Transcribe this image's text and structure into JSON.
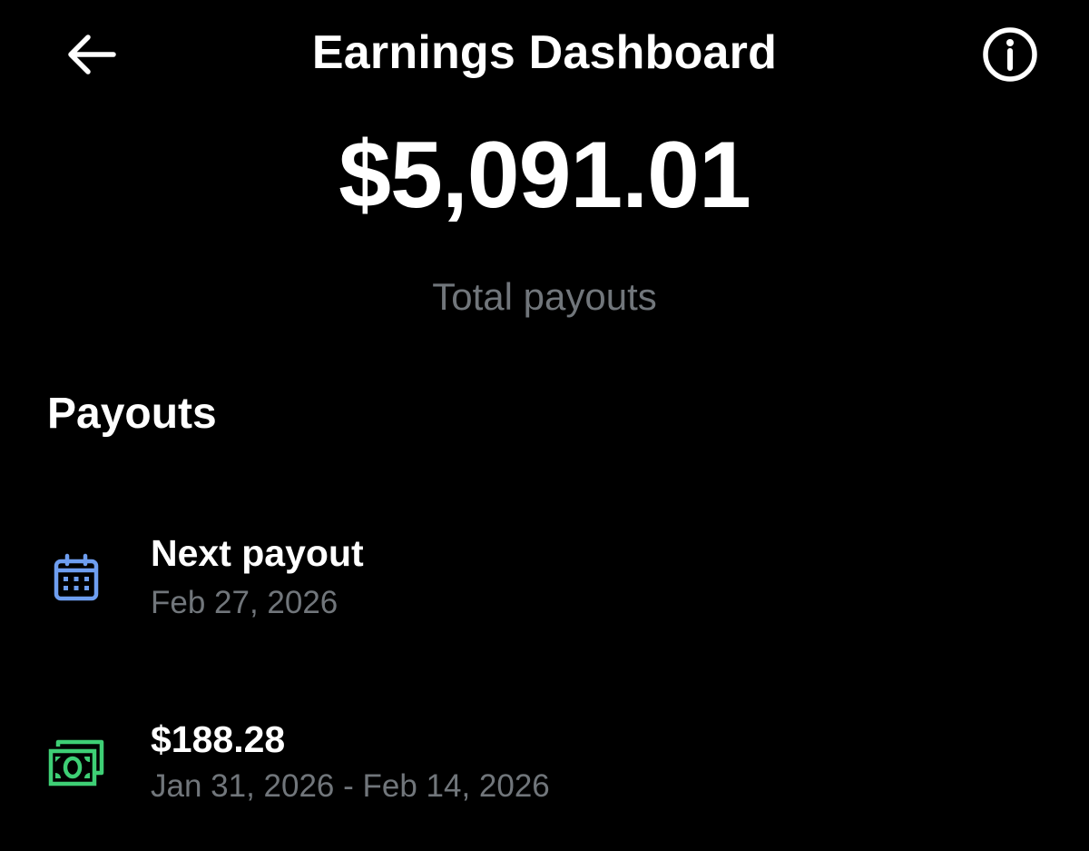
{
  "header": {
    "back_icon": "arrow-left-icon",
    "title": "Earnings Dashboard",
    "info_icon": "info-circle-icon"
  },
  "summary": {
    "total_amount": "$5,091.01",
    "total_label": "Total payouts"
  },
  "payouts": {
    "section_title": "Payouts",
    "items": [
      {
        "icon": "calendar-icon",
        "icon_color": "#6e9ef0",
        "title": "Next payout",
        "subtitle": "Feb 27, 2026"
      },
      {
        "icon": "cash-icon",
        "icon_color": "#3ecf75",
        "title": "$188.28",
        "subtitle": "Jan 31, 2026 - Feb 14, 2026"
      }
    ]
  },
  "colors": {
    "background": "#000000",
    "text_primary": "#ffffff",
    "text_secondary": "#71767b"
  }
}
